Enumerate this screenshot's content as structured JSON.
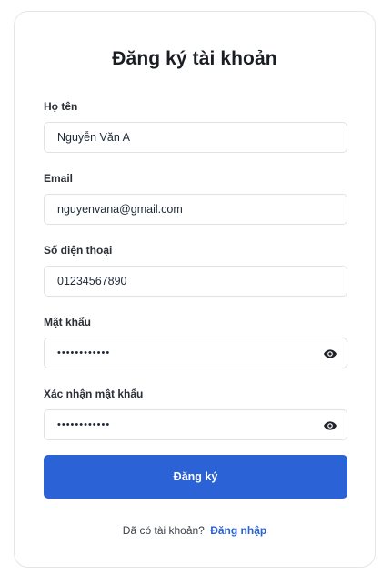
{
  "form": {
    "title": "Đăng ký tài khoản",
    "fields": [
      {
        "label": "Họ tên",
        "value": "Nguyễn Văn A",
        "type": "text"
      },
      {
        "label": "Email",
        "value": "nguyenvana@gmail.com",
        "type": "email"
      },
      {
        "label": "Số điện thoại",
        "value": "01234567890",
        "type": "tel"
      },
      {
        "label": "Mật khẩu",
        "value": "abcdefghijkl",
        "type": "password"
      },
      {
        "label": "Xác nhận mật khẩu",
        "value": "abcdefghijkl",
        "type": "password"
      }
    ],
    "submit_label": "Đăng ký",
    "footer_text": "Đã có tài khoản?",
    "footer_link": "Đăng nhập"
  },
  "icons": {
    "password_toggle": "eye-icon"
  },
  "colors": {
    "accent": "#2b63d6",
    "border": "#dfe2e6",
    "card_border": "#e3e5e8"
  }
}
